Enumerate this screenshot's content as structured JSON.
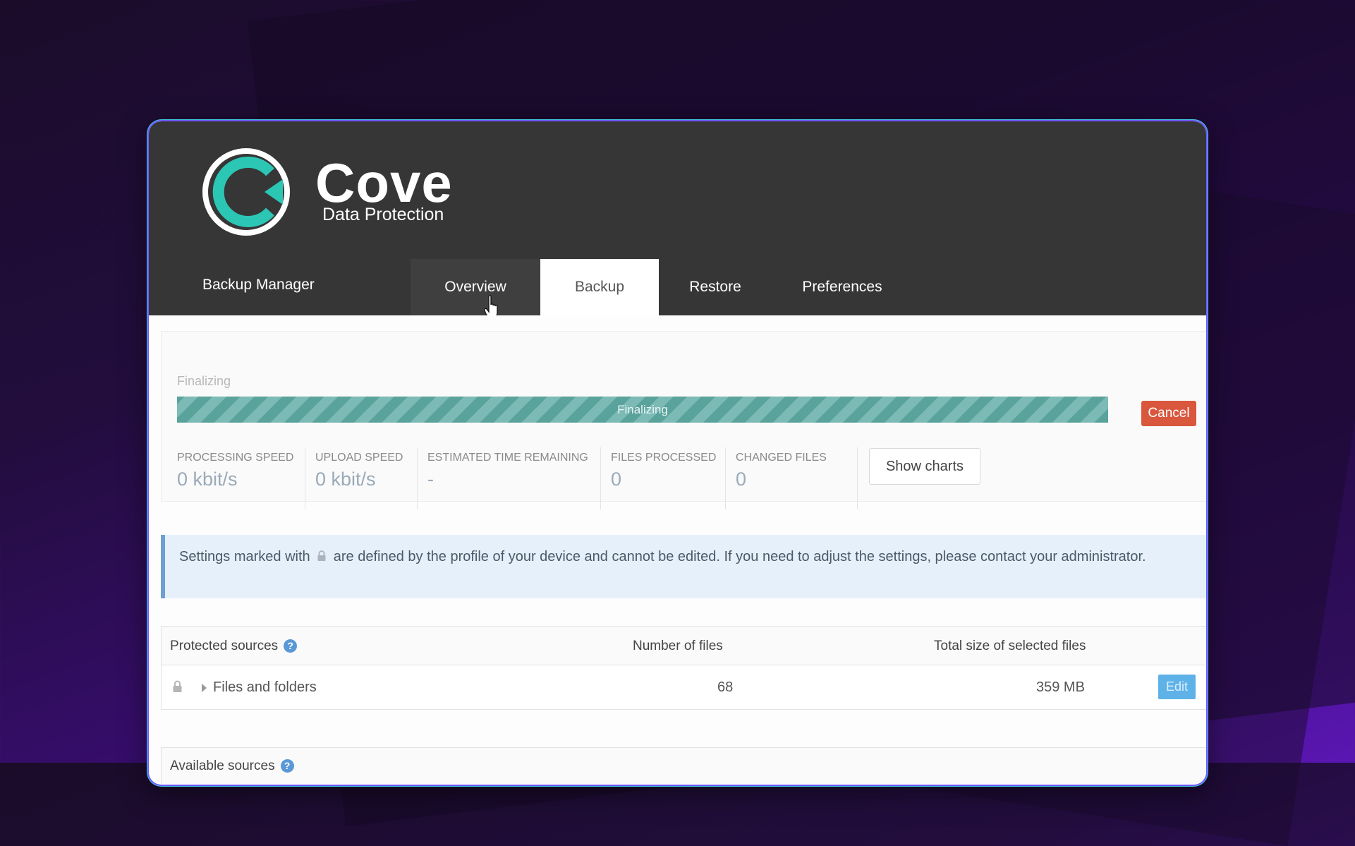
{
  "brand": {
    "name": "Cove",
    "subtitle": "Data Protection"
  },
  "nav": {
    "title": "Backup Manager",
    "tabs": [
      {
        "label": "Overview"
      },
      {
        "label": "Backup",
        "active": true
      },
      {
        "label": "Restore"
      },
      {
        "label": "Preferences"
      }
    ]
  },
  "progress": {
    "status_label": "Finalizing",
    "bar_text": "Finalizing",
    "cancel_label": "Cancel"
  },
  "stats": [
    {
      "label": "PROCESSING SPEED",
      "value": "0 kbit/s"
    },
    {
      "label": "UPLOAD SPEED",
      "value": "0 kbit/s"
    },
    {
      "label": "ESTIMATED TIME REMAINING",
      "value": "-"
    },
    {
      "label": "FILES PROCESSED",
      "value": "0"
    },
    {
      "label": "CHANGED FILES",
      "value": "0"
    }
  ],
  "show_charts_label": "Show charts",
  "info": {
    "text_before": "Settings marked with",
    "text_after": "are defined by the profile of your device and cannot be edited. If you need to adjust the settings, please contact your administrator."
  },
  "table": {
    "headers": {
      "source": "Protected sources",
      "files": "Number of files",
      "size": "Total size of selected files"
    },
    "rows": [
      {
        "name": "Files and folders",
        "files": "68",
        "size": "359 MB",
        "edit_label": "Edit"
      }
    ]
  },
  "available_sources": {
    "label": "Available sources"
  },
  "colors": {
    "header_bg": "#363636",
    "accent_teal": "#2cc6b4",
    "cancel_red": "#d8573d",
    "edit_blue": "#5fb2e8",
    "progress_teal": "#5aa29c"
  }
}
